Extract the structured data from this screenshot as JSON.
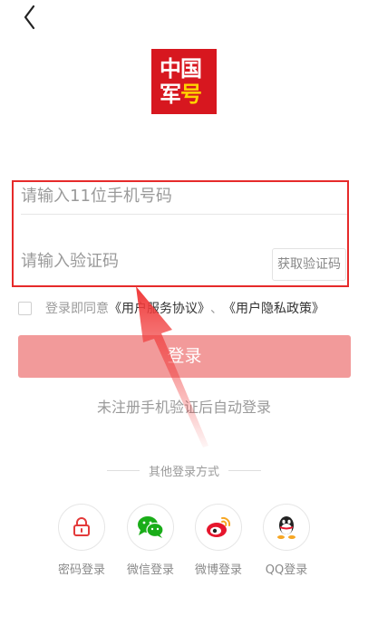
{
  "logo": {
    "row1": "中国",
    "row2_a": "军",
    "row2_b": "号"
  },
  "form": {
    "phone_placeholder": "请输入11位手机号码",
    "code_placeholder": "请输入验证码",
    "get_code_label": "获取验证码"
  },
  "agreement": {
    "prefix": "登录即同意",
    "service_link": "《用户服务协议》",
    "separator": "、",
    "privacy_link": "《用户隐私政策》"
  },
  "login_button": "登录",
  "hint": "未注册手机验证后自动登录",
  "other_login_title": "其他登录方式",
  "methods": [
    {
      "icon": "lock-icon",
      "label": "密码登录"
    },
    {
      "icon": "wechat-icon",
      "label": "微信登录"
    },
    {
      "icon": "weibo-icon",
      "label": "微博登录"
    },
    {
      "icon": "qq-icon",
      "label": "QQ登录"
    }
  ],
  "colors": {
    "brand_red": "#d7171f",
    "logo_gold": "#ffd200",
    "login_button": "#f29a9a",
    "highlight_border": "#e62a2a",
    "wechat_green": "#1aad19",
    "weibo_red": "#e6162d",
    "annotation_arrow": "#f03a3a"
  }
}
